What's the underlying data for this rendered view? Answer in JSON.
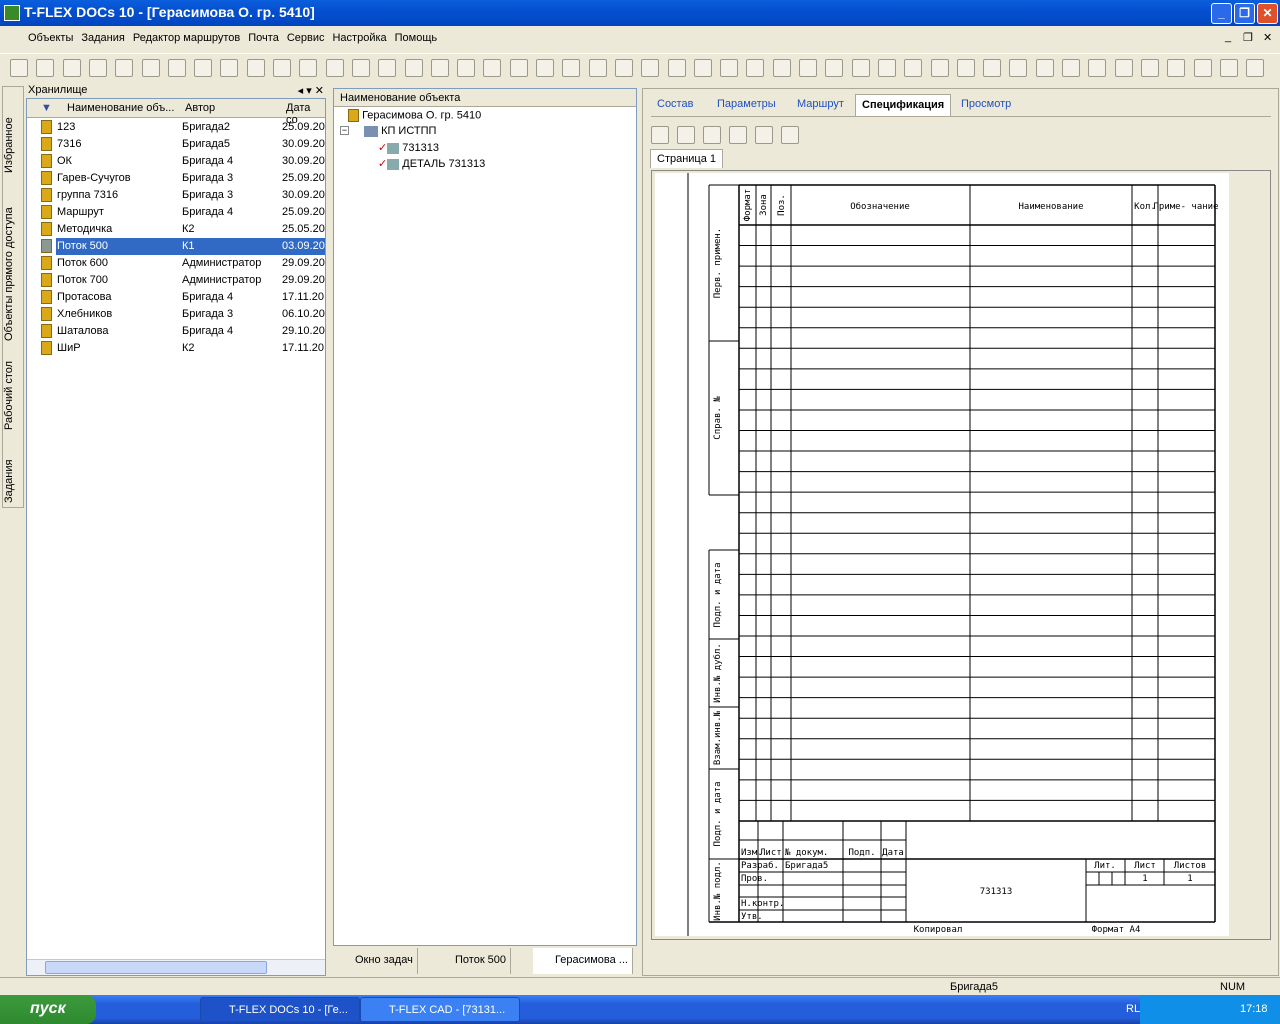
{
  "title": "T-FLEX DOCs 10 - [Герасимова  О. гр. 5410]",
  "menu": [
    "Объекты",
    "Задания",
    "Редактор маршрутов",
    "Почта",
    "Сервис",
    "Настройка",
    "Помощь"
  ],
  "side_tabs": [
    "Избранное",
    "Объекты прямого доступа",
    "Рабочий стол",
    "Задания"
  ],
  "storage": {
    "title": "Хранилище",
    "columns": [
      "Наименование объ...",
      "Автор",
      "Дата со"
    ],
    "rows": [
      [
        "123",
        "Бригада2",
        "25.09.20"
      ],
      [
        "7316",
        "Бригада5",
        "30.09.20"
      ],
      [
        "ОК",
        "Бригада 4",
        "30.09.20"
      ],
      [
        "Гарев-Сучугов",
        "Бригада 3",
        "25.09.20"
      ],
      [
        "группа 7316",
        "Бригада 3",
        "30.09.20"
      ],
      [
        "Маршрут",
        "Бригада 4",
        "25.09.20"
      ],
      [
        "Методичка",
        "К2",
        "25.05.20"
      ],
      [
        "Поток 500",
        "К1",
        "03.09.20"
      ],
      [
        "Поток 600",
        "Администратор",
        "29.09.20"
      ],
      [
        "Поток 700",
        "Администратор",
        "29.09.20"
      ],
      [
        "Протасова",
        "Бригада 4",
        "17.11.20"
      ],
      [
        "Хлебников",
        "Бригада 3",
        "06.10.20"
      ],
      [
        "Шаталова",
        "Бригада 4",
        "29.10.20"
      ],
      [
        "ШиР",
        "К2",
        "17.11.20"
      ]
    ],
    "selected_index": 7
  },
  "tree": {
    "header": "Наименование объекта",
    "root": "Герасимова  О. гр. 5410",
    "child": "КП ИСТПП",
    "leaves": [
      "731313",
      "ДЕТАЛЬ 731313"
    ]
  },
  "bottom_tabs": [
    "Окно задач",
    "Поток 500",
    "Герасимова ..."
  ],
  "right_tabs": [
    "Состав",
    "Параметры",
    "Маршрут",
    "Спецификация",
    "Просмотр"
  ],
  "active_right_tab": "Спецификация",
  "page_tab": "Страница 1",
  "spec": {
    "headers": [
      "Формат",
      "Зона",
      "Поз.",
      "Обозначение",
      "Наименование",
      "Кол.",
      "Приме-\nчание"
    ],
    "side_labels": [
      "Перв. примен.",
      "Справ. №",
      "Подп. и дата",
      "Инв.№ дубл.",
      "Взам.инв.№",
      "Подп. и дата",
      "Инв.№ подл."
    ],
    "stamp": {
      "izm": "Изм.",
      "list": "Лист",
      "ndoc": "№ докум.",
      "podp": "Подп.",
      "data": "Дата",
      "razrab": "Разраб.",
      "razrab_name": "Бригада5",
      "prov": "Пров.",
      "nkontr": "Н.контр.",
      "utv": "Утв.",
      "designation": "731313",
      "lit": "Лит.",
      "sheet": "Лист",
      "sheets": "Листов",
      "sheet_val": "1",
      "sheets_val": "1",
      "copied": "Копировал",
      "format": "Формат А4"
    }
  },
  "status": {
    "user": "Бригада5",
    "num": "NUM"
  },
  "taskbar": {
    "start": "пуск",
    "tasks": [
      "T-FLEX DOCs 10 - [Ге...",
      "T-FLEX CAD - [73131..."
    ],
    "lang": "RL",
    "time": "17:18"
  }
}
